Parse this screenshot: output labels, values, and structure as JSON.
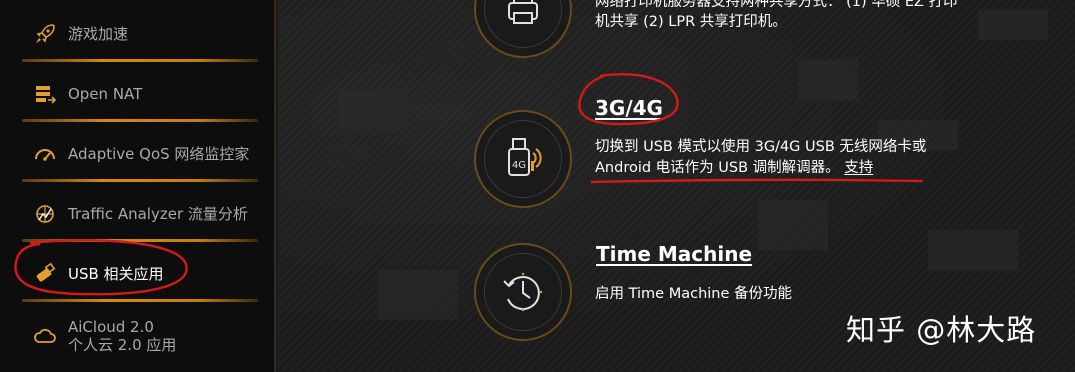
{
  "sidebar": {
    "items": [
      {
        "label": "游戏加速",
        "sub": ""
      },
      {
        "label": "Open NAT",
        "sub": ""
      },
      {
        "label": "Adaptive QoS 网络监控家",
        "sub": ""
      },
      {
        "label": "Traffic Analyzer 流量分析",
        "sub": ""
      },
      {
        "label": "USB 相关应用",
        "sub": ""
      },
      {
        "label": "AiCloud 2.0",
        "sub": "个人云 2.0 应用"
      }
    ],
    "active_index": 4
  },
  "features": {
    "printer": {
      "desc_line1": "网络打印机服务器支持两种共享方式： (1) 华硕 EZ 打印",
      "desc_line2": "机共享 (2) LPR 共享打印机。"
    },
    "modem": {
      "title": "3G/4G",
      "icon_text": "4G",
      "desc_line1": "切换到 USB 模式以使用 3G/4G USB 无线网络卡或",
      "desc_line2": "Android 电话作为 USB 调制解调器。",
      "support_link": "支持"
    },
    "timemachine": {
      "title": "Time Machine",
      "desc": "启用 Time Machine 备份功能"
    }
  },
  "watermark": "知乎 @林大路",
  "colors": {
    "accent": "#d48a14",
    "annotation": "#d11a1a"
  }
}
